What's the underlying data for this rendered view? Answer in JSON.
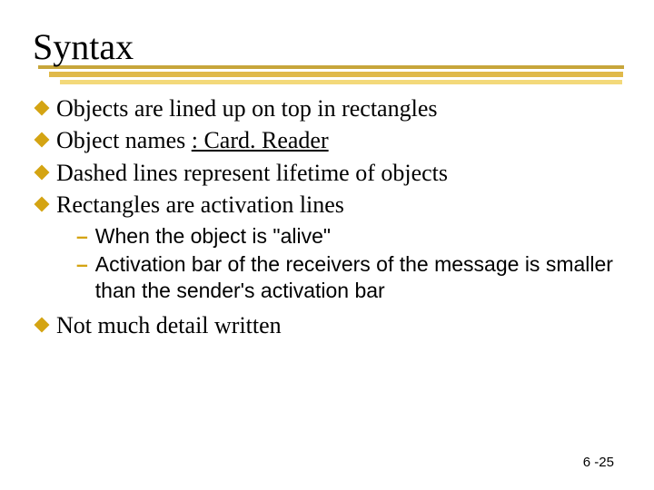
{
  "title": "Syntax",
  "bullets": [
    {
      "text": "Objects are lined up on top in rectangles"
    },
    {
      "prefix": "Object names ",
      "obj": ": Card. Reader"
    },
    {
      "text": "Dashed lines represent lifetime of objects"
    },
    {
      "text": "Rectangles are activation lines"
    }
  ],
  "sub": [
    "When the object is \"alive\"",
    "Activation bar of the receivers of the message is smaller than the sender's activation bar"
  ],
  "bullets2": [
    {
      "text": "Not much detail written"
    }
  ],
  "page": "6 -25"
}
